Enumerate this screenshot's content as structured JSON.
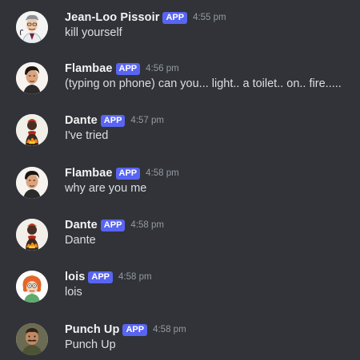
{
  "messages": [
    {
      "username": "Jean-Loo Pissoir",
      "badge": "APP",
      "time": "4:55 pm",
      "text": "kill yourself",
      "avatar": "doctor-avatar-icon"
    },
    {
      "username": "Flambae",
      "badge": "APP",
      "time": "4:56 pm",
      "text": "(typing on phone) can you... light.. a toilet.. on.. fire.....",
      "avatar": "man-avatar-icon"
    },
    {
      "username": "Dante",
      "badge": "APP",
      "time": "4:57 pm",
      "text": "I've tried",
      "avatar": "fiery-figure-avatar-icon"
    },
    {
      "username": "Flambae",
      "badge": "APP",
      "time": "4:58 pm",
      "text": "why are you me",
      "avatar": "man-avatar-icon"
    },
    {
      "username": "Dante",
      "badge": "APP",
      "time": "4:58 pm",
      "text": "Dante",
      "avatar": "fiery-figure-avatar-icon"
    },
    {
      "username": "lois",
      "badge": "APP",
      "time": "4:58 pm",
      "text": "lois",
      "avatar": "red-hair-woman-avatar-icon"
    },
    {
      "username": "Punch Up",
      "badge": "APP",
      "time": "4:58 pm",
      "text": "Punch Up",
      "avatar": "mustache-man-avatar-icon"
    }
  ],
  "colors": {
    "background": "#313338",
    "username": "#f2f3f5",
    "text": "#dbdee1",
    "timestamp": "#949ba4",
    "badge": "#5865f2"
  }
}
